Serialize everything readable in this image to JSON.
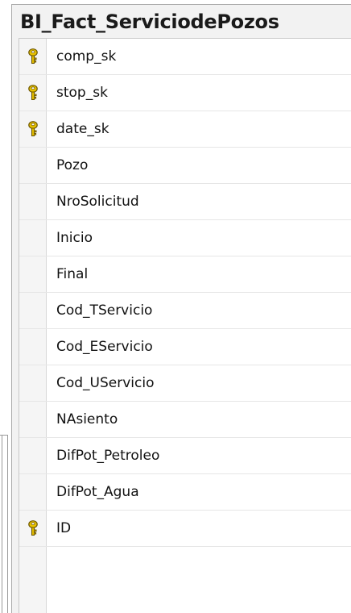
{
  "table": {
    "title": "BI_Fact_ServiciodePozos",
    "columns": [
      {
        "name": "comp_sk",
        "primary_key": true
      },
      {
        "name": "stop_sk",
        "primary_key": true
      },
      {
        "name": "date_sk",
        "primary_key": true
      },
      {
        "name": "Pozo",
        "primary_key": false
      },
      {
        "name": "NroSolicitud",
        "primary_key": false
      },
      {
        "name": "Inicio",
        "primary_key": false
      },
      {
        "name": "Final",
        "primary_key": false
      },
      {
        "name": "Cod_TServicio",
        "primary_key": false
      },
      {
        "name": "Cod_EServicio",
        "primary_key": false
      },
      {
        "name": "Cod_UServicio",
        "primary_key": false
      },
      {
        "name": "NAsiento",
        "primary_key": false
      },
      {
        "name": "DifPot_Petroleo",
        "primary_key": false
      },
      {
        "name": "DifPot_Agua",
        "primary_key": false
      },
      {
        "name": "ID",
        "primary_key": true
      }
    ]
  },
  "colors": {
    "key_fill": "#e8c200",
    "key_outline": "#6b5500"
  },
  "icons": {
    "primary_key": "key-icon"
  }
}
